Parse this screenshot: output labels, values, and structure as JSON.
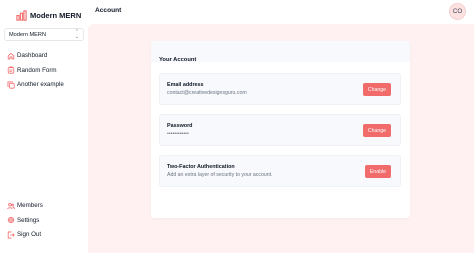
{
  "app": {
    "name": "Modern MERN"
  },
  "workspace": {
    "selected": "Modern MERN"
  },
  "nav": {
    "items": [
      {
        "label": "Dashboard"
      },
      {
        "label": "Random Form"
      },
      {
        "label": "Another example"
      }
    ],
    "bottom": [
      {
        "label": "Members"
      },
      {
        "label": "Settings"
      },
      {
        "label": "Sign Out"
      }
    ]
  },
  "header": {
    "title": "Account",
    "avatar_initials": "CO"
  },
  "account": {
    "title": "Your Account",
    "email": {
      "label": "Email address",
      "value": "contact@creativedesignsguru.com",
      "button": "Change"
    },
    "password": {
      "label": "Password",
      "value": "••••••••••••",
      "button": "Change"
    },
    "twofa": {
      "label": "Two-Factor Authentication",
      "description": "Add an extra layer of security to your account.",
      "button": "Enable"
    }
  },
  "colors": {
    "accent": "#f16b6b",
    "main_bg": "#fff1f1",
    "row_bg": "#f7f9fc"
  }
}
